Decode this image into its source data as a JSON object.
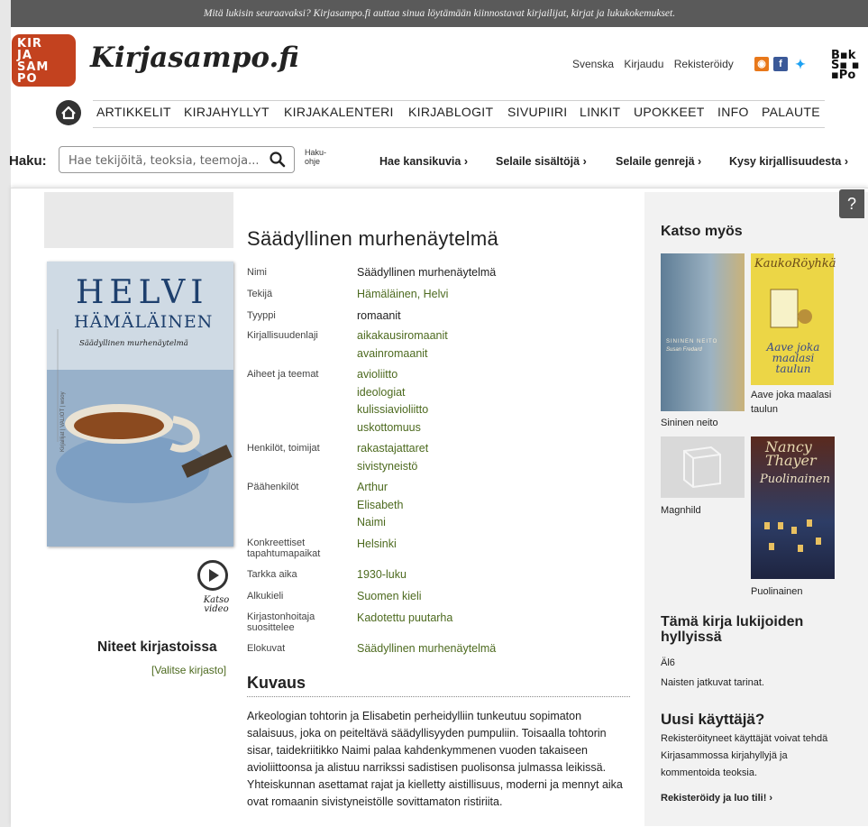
{
  "banner": "Mitä lukisin seuraavaksi? Kirjasampo.fi auttaa sinua löytämään kiinnostavat kirjailijat, kirjat ja lukukokemukset.",
  "site": {
    "logo_text": "KIRJASAMPO",
    "name": "Kirjasampo.fi",
    "booksampo": "BOOKSAMPO"
  },
  "toplinks": [
    "Svenska",
    "Kirjaudu",
    "Rekisteröidy"
  ],
  "nav": [
    "ARTIKKELIT",
    "KIRJAHYLLYT",
    "KIRJAKALENTERI",
    "KIRJABLOGIT",
    "SIVUPIIRI",
    "LINKIT",
    "UPOKKEET",
    "INFO",
    "PALAUTE"
  ],
  "search": {
    "label": "Haku:",
    "placeholder": "Hae tekijöitä, teoksia, teemoja...",
    "help": "Haku-\nohje"
  },
  "quick": [
    "Hae kansikuvia",
    "Selaile sisältöjä",
    "Selaile genrejä",
    "Kysy kirjallisuudesta"
  ],
  "cover": {
    "author_first": "HELVI",
    "author_last": "HÄMÄLÄINEN",
    "title": "Säädyllinen murhenäytelmä",
    "spine": "Kirjailijat | VALIOT | wsoy"
  },
  "video": {
    "label": "Katso video"
  },
  "book": {
    "title": "Säädyllinen murhenäytelmä",
    "fields": [
      {
        "label": "Nimi",
        "values": [
          "Säädyllinen murhenäytelmä"
        ],
        "link": false
      },
      {
        "label": "Tekijä",
        "values": [
          "Hämäläinen, Helvi"
        ],
        "link": true
      },
      {
        "label": "Tyyppi",
        "values": [
          "romaanit"
        ],
        "link": false
      },
      {
        "label": "Kirjallisuudenlaji",
        "values": [
          "aikakausiromaanit",
          "avainromaanit"
        ],
        "link": true
      },
      {
        "label": "Aiheet ja teemat",
        "values": [
          "avioliitto",
          "ideologiat",
          "kulissiavioliitto",
          "uskottomuus"
        ],
        "link": true
      },
      {
        "label": "Henkilöt, toimijat",
        "values": [
          "rakastajattaret",
          "sivistyneistö"
        ],
        "link": true
      },
      {
        "label": "Päähenkilöt",
        "values": [
          "Arthur",
          "Elisabeth",
          "Naimi"
        ],
        "link": true
      },
      {
        "label": "Konkreettiset tapahtumapaikat",
        "values": [
          "Helsinki"
        ],
        "link": true
      },
      {
        "label": "Tarkka aika",
        "values": [
          "1930-luku"
        ],
        "link": true
      },
      {
        "label": "Alkukieli",
        "values": [
          "Suomen kieli"
        ],
        "link": true
      },
      {
        "label": "Kirjastonhoitaja suosittelee",
        "values": [
          "Kadotettu puutarha"
        ],
        "link": true
      },
      {
        "label": "Elokuvat",
        "values": [
          "Säädyllinen murhenäytelmä"
        ],
        "link": true
      }
    ]
  },
  "kuvaus": {
    "heading": "Kuvaus",
    "text": "Arkeologian tohtorin ja Elisabetin perheidylliin tunkeutuu sopimaton salaisuus, joka on peiteltävä säädyllisyyden pumpuliin. Toisaalla tohtorin sisar, taidekriitikko Naimi palaa kahdenkymmenen vuoden takaiseen avioliittoonsa ja alistuu narrikssi sadistisen puolisonsa julmassa leikissä. Yhteiskunnan asettamat rajat ja kielletty aistillisuus, moderni ja mennyt aika ovat romaanin sivistyneistölle sovittamaton ristiriita."
  },
  "library": {
    "heading": "Niteet kirjastoissa",
    "select": "[Valitse kirjasto]"
  },
  "see_also": {
    "heading": "Katso myös",
    "items": [
      {
        "title": "Sininen neito",
        "cover_text": "SININEN NEITO · Susan Fredard",
        "color": "#6f8fa8"
      },
      {
        "title": "Aave joka maalasi taulun",
        "cover_text": "Kauko Röyhkä · Aave joka maalasi taulun",
        "color": "#e8d23c"
      },
      {
        "title": "Magnhild",
        "cover_text": "",
        "color": "#d9d9d9"
      },
      {
        "title": "Puolinainen",
        "cover_text": "Nancy Thayer · Puolinainen",
        "color": "#4a2a22"
      }
    ]
  },
  "shelves": {
    "heading": "Tämä kirja lukijoiden hyllyissä",
    "items": [
      "Äl6",
      "Naisten jatkuvat tarinat."
    ]
  },
  "new_user": {
    "heading": "Uusi käyttäjä?",
    "text": "Rekisteröityneet käyttäjät voivat tehdä Kirjasammossa kirjahyllyjä ja kommentoida teoksia.",
    "link": "Rekisteröidy ja luo tili!"
  },
  "colors": {
    "link": "#4d6a1f",
    "logo": "#c3421f",
    "banner": "#5a5a5a"
  }
}
